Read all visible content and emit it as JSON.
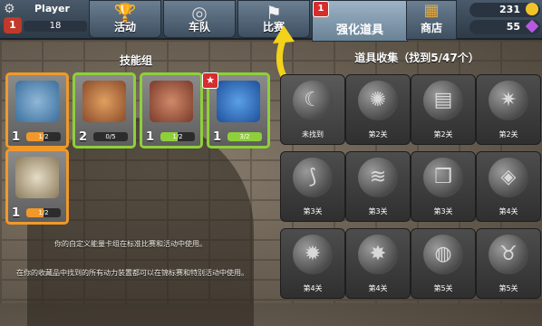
{
  "player": {
    "name": "Player",
    "level": "1",
    "xp": "18"
  },
  "tabs": [
    {
      "label": "活动",
      "icon": "trophy-icon"
    },
    {
      "label": "车队",
      "icon": "steering-wheel-icon"
    },
    {
      "label": "比赛",
      "icon": "checkered-flag-icon"
    }
  ],
  "powerups_tab": {
    "label": "强化道具",
    "badge": "1"
  },
  "shop_tab": {
    "label": "商店"
  },
  "currency": {
    "coins": "231",
    "gems": "55"
  },
  "skill_group": {
    "title": "技能组",
    "cards": [
      {
        "count": "1",
        "progress": "1/2",
        "border": "#f0992a",
        "fill": 0.5
      },
      {
        "count": "2",
        "progress": "0/5",
        "border": "#8fcf3a",
        "fill": 0
      },
      {
        "count": "1",
        "progress": "1/2",
        "border": "#8fcf3a",
        "fill": 0.5
      },
      {
        "count": "1",
        "progress": "3/2",
        "border": "#8fcf3a",
        "fill": 1
      },
      {
        "count": "1",
        "progress": "1/2",
        "border": "#f0992a",
        "fill": 0.5
      }
    ],
    "star_badge": "★",
    "info1": "你的自定义能量卡组在标准比赛和活动中使用。",
    "info2": "在你的收藏品中找到的所有动力装置都可以在锦标赛和特别活动中使用。"
  },
  "collection": {
    "title": "道具收集（找到5/47个）",
    "cards": [
      {
        "label": "未找到",
        "icon": "wolf-icon"
      },
      {
        "label": "第2关",
        "icon": "explosion-icon"
      },
      {
        "label": "第2关",
        "icon": "barrels-icon"
      },
      {
        "label": "第2关",
        "icon": "sparkle-ring-icon"
      },
      {
        "label": "第3关",
        "icon": "claw-icon"
      },
      {
        "label": "第3关",
        "icon": "shockwave-icon"
      },
      {
        "label": "第3关",
        "icon": "box-burst-icon"
      },
      {
        "label": "第4关",
        "icon": "ice-cube-icon"
      },
      {
        "label": "第4关",
        "icon": "spike-ball-icon"
      },
      {
        "label": "第4关",
        "icon": "spike-mine-icon"
      },
      {
        "label": "第5关",
        "icon": "saw-disc-icon"
      },
      {
        "label": "第5关",
        "icon": "horns-icon"
      }
    ]
  }
}
